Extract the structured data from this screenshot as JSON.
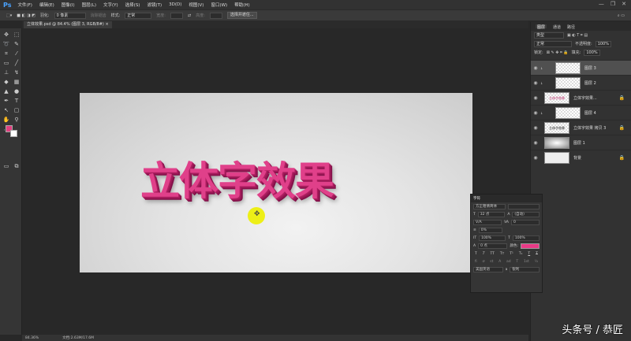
{
  "app": {
    "logo": "Ps",
    "menu": [
      "文件(F)",
      "编辑(E)",
      "图像(I)",
      "图层(L)",
      "文字(Y)",
      "选择(S)",
      "滤镜(T)",
      "3D(D)",
      "视图(V)",
      "窗口(W)",
      "帮助(H)"
    ],
    "window_controls": [
      "—",
      "❐",
      "✕"
    ]
  },
  "options": {
    "feather_label": "羽化:",
    "feather_value": "0 像素",
    "antialias": "消除锯齿",
    "style_label": "样式:",
    "style_value": "正常",
    "width_label": "宽度:",
    "height_label": "高度:",
    "select_mask": "选择并遮住..."
  },
  "document": {
    "tab_label": "立体效果.psd @ 84.4% (图层 3, RGB/8#) ×",
    "art_text": "立体字效果"
  },
  "status": {
    "zoom": "84.36%",
    "doc": "文档:2.63M/17.6M"
  },
  "colors": {
    "foreground": "#e0407f",
    "background": "#ffffff"
  },
  "layers_panel": {
    "tabs": [
      "图层",
      "通道",
      "路径"
    ],
    "filter": "类型",
    "blend": "正常",
    "opacity_label": "不透明度:",
    "opacity": "100%",
    "lock_label": "锁定:",
    "fill_label": "填充:",
    "fill": "100%",
    "layers": [
      {
        "name": "图层 3",
        "thumb": "",
        "selected": true,
        "locked": false
      },
      {
        "name": "图层 2",
        "thumb": "",
        "selected": false,
        "locked": false
      },
      {
        "name": "立体字效果...",
        "thumb": "立体字效果",
        "selected": false,
        "locked": true
      },
      {
        "name": "图层 4",
        "thumb": "",
        "selected": false,
        "locked": false
      },
      {
        "name": "立体字效果 拷贝 3",
        "thumb": "立体字效果",
        "selected": false,
        "locked": true
      },
      {
        "name": "图层 1",
        "thumb": "",
        "selected": false,
        "locked": false
      },
      {
        "name": "背景",
        "thumb": "",
        "selected": false,
        "locked": true
      }
    ]
  },
  "character_panel": {
    "title": "字符",
    "font": "方正粗倩简体",
    "size": "32 点",
    "leading": "(自动)",
    "kerning": "V/A",
    "tracking": "0",
    "scale_pct": "0%",
    "vscale": "100%",
    "hscale": "100%",
    "baseline": "0 点",
    "color_label": "颜色:",
    "language": "美国英语",
    "aa_label": "a",
    "aa": "锐利"
  },
  "watermark": "头条号 / 恭匠"
}
